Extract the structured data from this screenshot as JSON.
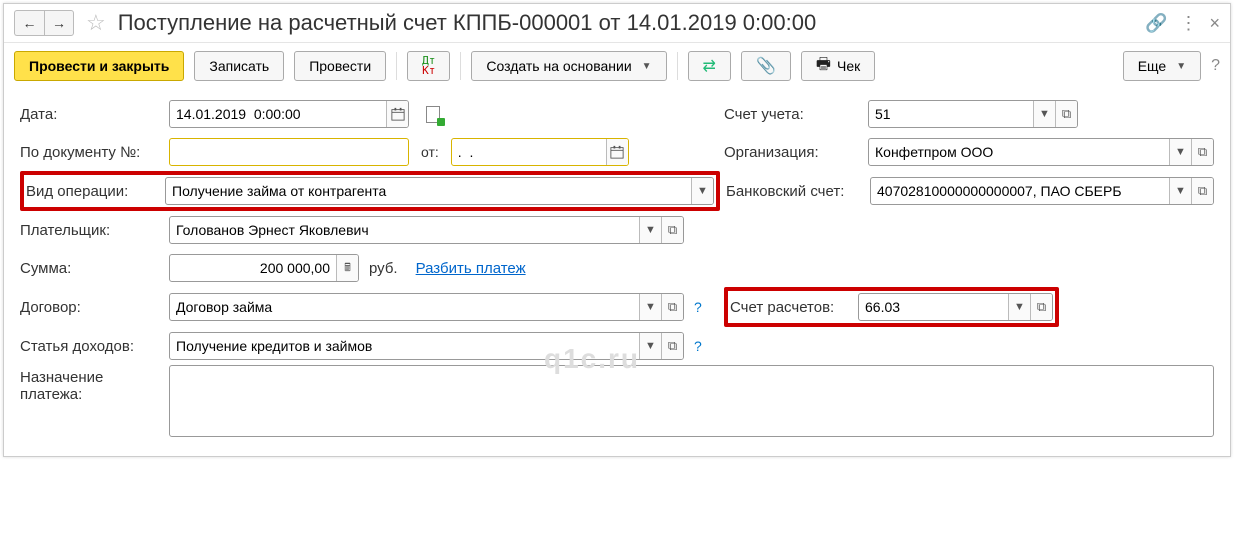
{
  "title": "Поступление на расчетный счет КППБ-000001 от 14.01.2019 0:00:00",
  "toolbar": {
    "save_close": "Провести и закрыть",
    "write": "Записать",
    "post": "Провести",
    "create_based": "Создать на основании",
    "check": "Чек",
    "more": "Еще"
  },
  "labels": {
    "date": "Дата:",
    "by_doc": "По документу №:",
    "from": "от:",
    "op_type": "Вид операции:",
    "payer": "Плательщик:",
    "sum": "Сумма:",
    "contract": "Договор:",
    "income_item": "Статья доходов:",
    "purpose1": "Назначение",
    "purpose2": "платежа:",
    "account": "Счет учета:",
    "org": "Организация:",
    "bank_acc": "Банковский счет:",
    "settle_acc": "Счет расчетов:"
  },
  "values": {
    "date": "14.01.2019  0:00:00",
    "doc_no": "",
    "doc_from": ".  .",
    "op_type": "Получение займа от контрагента",
    "payer": "Голованов Эрнест Яковлевич",
    "sum": "200 000,00",
    "currency": "руб.",
    "split_link": "Разбить платеж",
    "contract": "Договор займа",
    "income_item": "Получение кредитов и займов",
    "purpose": "",
    "account": "51",
    "org": "Конфетпром ООО",
    "bank_acc": "40702810000000000007, ПАО СБЕРБ",
    "settle_acc": "66.03"
  },
  "watermark": "q1c.ru"
}
